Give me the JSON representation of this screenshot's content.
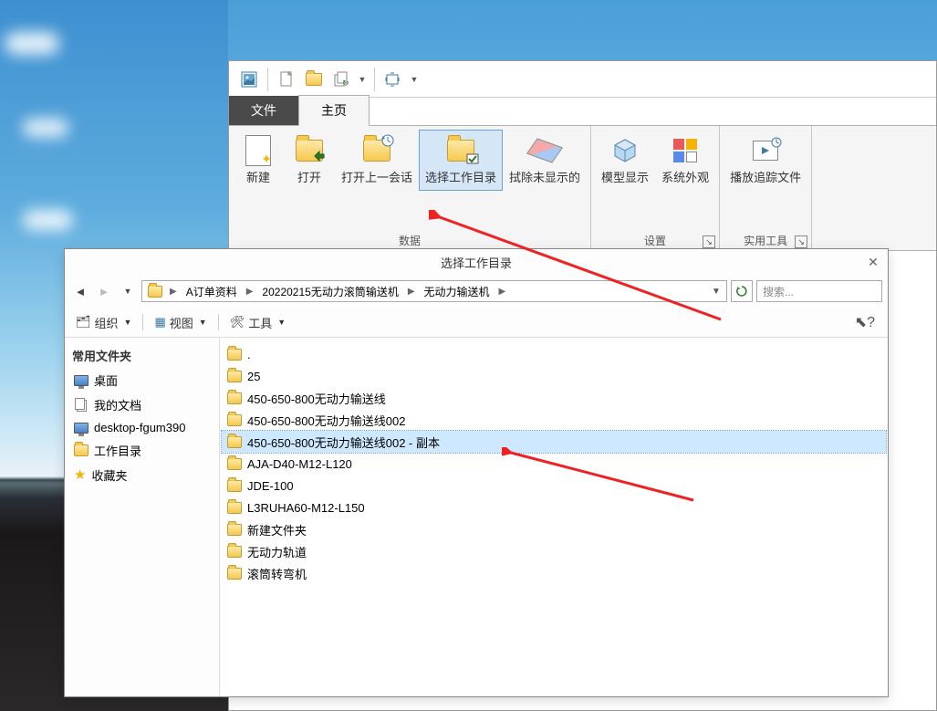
{
  "ribbon": {
    "tabs": {
      "file": "文件",
      "home": "主页"
    },
    "groups": {
      "data": {
        "label": "数据",
        "new": "新建",
        "open": "打开",
        "open_prev": "打开上一会话",
        "select_dir": "选择工作目录",
        "erase": "拭除未显示的"
      },
      "settings": {
        "label": "设置",
        "model_display": "模型显示",
        "appearance": "系统外观"
      },
      "tools": {
        "label": "实用工具",
        "play_track": "播放追踪文件"
      }
    }
  },
  "dialog": {
    "title": "选择工作目录",
    "breadcrumb": [
      "A订单资料",
      "20220215无动力滚筒输送机",
      "无动力输送机"
    ],
    "search_placeholder": "搜索...",
    "toolbar": {
      "organize": "组织",
      "view": "视图",
      "tools": "工具"
    },
    "sidebar": {
      "header": "常用文件夹",
      "items": [
        {
          "id": "desktop",
          "label": "桌面"
        },
        {
          "id": "documents",
          "label": "我的文档"
        },
        {
          "id": "remote",
          "label": "desktop-fgum390"
        },
        {
          "id": "workdir",
          "label": "工作目录"
        },
        {
          "id": "favorites",
          "label": "收藏夹"
        }
      ]
    },
    "files": [
      {
        "name": ".",
        "selected": false
      },
      {
        "name": "25",
        "selected": false
      },
      {
        "name": "450-650-800无动力输送线",
        "selected": false
      },
      {
        "name": "450-650-800无动力输送线002",
        "selected": false
      },
      {
        "name": "450-650-800无动力输送线002 - 副本",
        "selected": true
      },
      {
        "name": "AJA-D40-M12-L120",
        "selected": false
      },
      {
        "name": "JDE-100",
        "selected": false
      },
      {
        "name": "L3RUHA60-M12-L150",
        "selected": false
      },
      {
        "name": "新建文件夹",
        "selected": false
      },
      {
        "name": "无动力轨道",
        "selected": false
      },
      {
        "name": "滚筒转弯机",
        "selected": false
      }
    ]
  }
}
